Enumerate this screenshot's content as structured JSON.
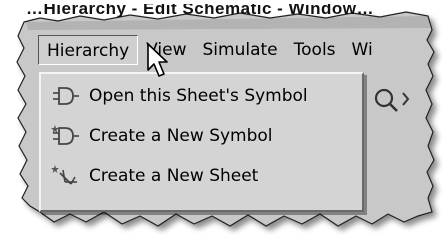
{
  "clipped_title": "…Hierarchy - Edit Schematic - Window…",
  "menubar": {
    "items": [
      {
        "label": "Hierarchy",
        "active": true
      },
      {
        "label": "View",
        "active": false
      },
      {
        "label": "Simulate",
        "active": false
      },
      {
        "label": "Tools",
        "active": false
      },
      {
        "label": "Wi",
        "active": false
      }
    ]
  },
  "dropdown": {
    "items": [
      {
        "label": "Open this Sheet's Symbol",
        "icon": "open-symbol-icon"
      },
      {
        "label": "Create a New Symbol",
        "icon": "new-symbol-icon"
      },
      {
        "label": "Create a New Sheet",
        "icon": "new-sheet-icon"
      }
    ]
  },
  "colors": {
    "menu_background": "#d4d4d4",
    "highlight_light": "#f4f4f4",
    "highlight_dark": "#6a6a6a",
    "text": "#000000"
  }
}
